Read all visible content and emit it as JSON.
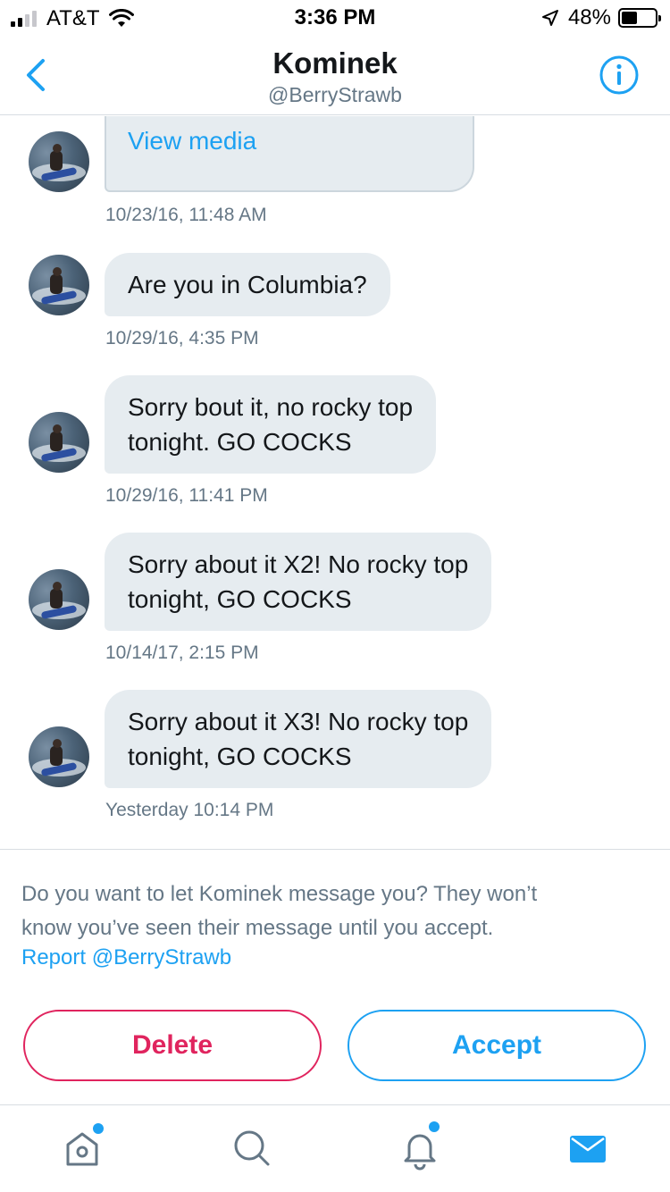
{
  "status_bar": {
    "carrier": "AT&T",
    "time": "3:36 PM",
    "battery_percent": "48%",
    "battery_level": 0.48,
    "signal_bars_active": 2,
    "signal_bars_total": 4
  },
  "header": {
    "title": "Kominek",
    "handle": "@BerryStrawb",
    "back_icon": "chevron-left-icon",
    "info_icon": "info-circle-icon"
  },
  "messages": [
    {
      "type": "media",
      "link_text": "View media",
      "timestamp": "10/23/16, 11:48 AM"
    },
    {
      "type": "text",
      "lines": [
        "Are you in Columbia?"
      ],
      "timestamp": "10/29/16, 4:35 PM"
    },
    {
      "type": "text",
      "lines": [
        "Sorry bout it, no rocky top",
        "tonight.  GO COCKS"
      ],
      "timestamp": "10/29/16, 11:41 PM"
    },
    {
      "type": "text",
      "lines": [
        "Sorry about it X2! No rocky top",
        "tonight, GO COCKS"
      ],
      "timestamp": "10/14/17, 2:15 PM"
    },
    {
      "type": "text",
      "lines": [
        "Sorry about it X3! No rocky top",
        "tonight, GO COCKS"
      ],
      "timestamp": "Yesterday 10:14 PM"
    }
  ],
  "request": {
    "prompt_line1": "Do you want to let Kominek message you? They won’t",
    "prompt_line2": "know you’ve seen their message until you accept.",
    "report_label": "Report @BerryStrawb"
  },
  "actions": {
    "delete_label": "Delete",
    "accept_label": "Accept"
  },
  "tabbar": {
    "items": [
      {
        "icon": "home-icon",
        "has_dot": true
      },
      {
        "icon": "search-icon",
        "has_dot": false
      },
      {
        "icon": "bell-icon",
        "has_dot": true
      },
      {
        "icon": "mail-icon",
        "has_dot": false,
        "active": true
      }
    ]
  },
  "colors": {
    "accent": "#1da1f2",
    "danger": "#e0245e",
    "bubble": "#e6ecf0",
    "secondary_text": "#657786"
  }
}
